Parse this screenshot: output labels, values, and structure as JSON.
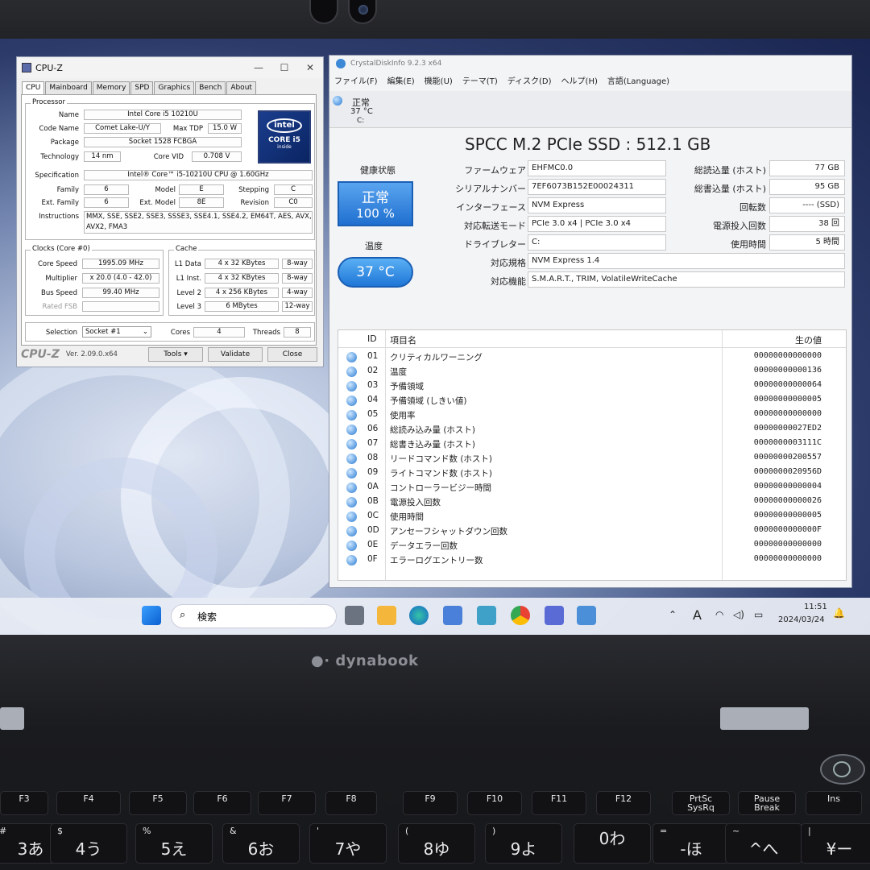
{
  "cpuz": {
    "title": "CPU-Z",
    "tabs": [
      "CPU",
      "Mainboard",
      "Memory",
      "SPD",
      "Graphics",
      "Bench",
      "About"
    ],
    "processor": {
      "group": "Processor",
      "name_label": "Name",
      "name": "Intel Core i5 10210U",
      "codename_label": "Code Name",
      "codename": "Comet Lake-U/Y",
      "tdp_label": "Max TDP",
      "tdp": "15.0 W",
      "package_label": "Package",
      "package": "Socket 1528 FCBGA",
      "tech_label": "Technology",
      "tech": "14 nm",
      "vid_label": "Core VID",
      "vid": "0.708 V",
      "spec_label": "Specification",
      "spec": "Intel® Core™ i5-10210U CPU @ 1.60GHz",
      "family_label": "Family",
      "family": "6",
      "model_label": "Model",
      "model": "E",
      "stepping_label": "Stepping",
      "stepping": "C",
      "extfamily_label": "Ext. Family",
      "extfamily": "6",
      "extmodel_label": "Ext. Model",
      "extmodel": "8E",
      "revision_label": "Revision",
      "revision": "C0",
      "instr_label": "Instructions",
      "instr": "MMX, SSE, SSE2, SSE3, SSSE3, SSE4.1, SSE4.2, EM64T, AES, AVX, AVX2, FMA3",
      "badge_brand": "intel",
      "badge_line": "CORE i5",
      "badge_inside": "inside"
    },
    "clocks": {
      "group": "Clocks (Core #0)",
      "core_speed_label": "Core Speed",
      "core_speed": "1995.09 MHz",
      "multiplier_label": "Multiplier",
      "multiplier": "x 20.0 (4.0 - 42.0)",
      "bus_label": "Bus Speed",
      "bus": "99.40 MHz",
      "fsb_label": "Rated FSB",
      "fsb": ""
    },
    "cache": {
      "group": "Cache",
      "l1d_label": "L1 Data",
      "l1d": "4 x 32 KBytes",
      "l1d_way": "8-way",
      "l1i_label": "L1 Inst.",
      "l1i": "4 x 32 KBytes",
      "l1i_way": "8-way",
      "l2_label": "Level 2",
      "l2": "4 x 256 KBytes",
      "l2_way": "4-way",
      "l3_label": "Level 3",
      "l3": "6 MBytes",
      "l3_way": "12-way"
    },
    "selection_label": "Selection",
    "selection": "Socket #1",
    "cores_label": "Cores",
    "cores": "4",
    "threads_label": "Threads",
    "threads": "8",
    "brand": "CPU-Z",
    "version": "Ver. 2.09.0.x64",
    "tools_label": "Tools",
    "validate_label": "Validate",
    "close_label": "Close"
  },
  "cdi": {
    "title": "CrystalDiskInfo 9.2.3 x64",
    "menu": [
      "ファイル(F)",
      "編集(E)",
      "機能(U)",
      "テーマ(T)",
      "ディスク(D)",
      "ヘルプ(H)",
      "言語(Language)"
    ],
    "drive_status": "正常",
    "drive_temp": "37 °C",
    "drive_letter": "C:",
    "disk_title": "SPCC M.2 PCIe SSD : 512.1 GB",
    "health_label": "健康状態",
    "health_status": "正常",
    "health_pct": "100 %",
    "temp_label": "温度",
    "temp": "37 °C",
    "firmware_label": "ファームウェア",
    "firmware": "EHFMC0.0",
    "serial_label": "シリアルナンバー",
    "serial": "7EF6073B152E00024311",
    "interface_label": "インターフェース",
    "interface": "NVM Express",
    "transfer_label": "対応転送モード",
    "transfer": "PCIe 3.0 x4 | PCIe 3.0 x4",
    "driveletter_label": "ドライブレター",
    "driveletter": "C:",
    "standard_label": "対応規格",
    "standard": "NVM Express 1.4",
    "features_label": "対応機能",
    "features": "S.M.A.R.T., TRIM, VolatileWriteCache",
    "read_label": "総読込量 (ホスト)",
    "read": "77 GB",
    "write_label": "総書込量 (ホスト)",
    "write": "95 GB",
    "rpm_label": "回転数",
    "rpm": "---- (SSD)",
    "poweron_count_label": "電源投入回数",
    "poweron_count": "38 回",
    "hours_label": "使用時間",
    "hours": "5 時間",
    "smart_header": {
      "id": "ID",
      "item": "項目名",
      "raw": "生の値"
    },
    "smart": [
      {
        "id": "01",
        "name": "クリティカルワーニング",
        "raw": "00000000000000"
      },
      {
        "id": "02",
        "name": "温度",
        "raw": "00000000000136"
      },
      {
        "id": "03",
        "name": "予備領域",
        "raw": "00000000000064"
      },
      {
        "id": "04",
        "name": "予備領域 (しきい値)",
        "raw": "00000000000005"
      },
      {
        "id": "05",
        "name": "使用率",
        "raw": "00000000000000"
      },
      {
        "id": "06",
        "name": "総読み込み量 (ホスト)",
        "raw": "00000000027ED2"
      },
      {
        "id": "07",
        "name": "総書き込み量 (ホスト)",
        "raw": "0000000003111C"
      },
      {
        "id": "08",
        "name": "リードコマンド数 (ホスト)",
        "raw": "00000000200557"
      },
      {
        "id": "09",
        "name": "ライトコマンド数 (ホスト)",
        "raw": "0000000020956D"
      },
      {
        "id": "0A",
        "name": "コントローラービジー時間",
        "raw": "00000000000004"
      },
      {
        "id": "0B",
        "name": "電源投入回数",
        "raw": "00000000000026"
      },
      {
        "id": "0C",
        "name": "使用時間",
        "raw": "00000000000005"
      },
      {
        "id": "0D",
        "name": "アンセーフシャットダウン回数",
        "raw": "0000000000000F"
      },
      {
        "id": "0E",
        "name": "データエラー回数",
        "raw": "00000000000000"
      },
      {
        "id": "0F",
        "name": "エラーログエントリー数",
        "raw": "00000000000000"
      }
    ]
  },
  "taskbar": {
    "search_placeholder": "検索",
    "ime": "A",
    "time": "11:51",
    "date": "2024/03/24"
  },
  "laptop": {
    "brand": "dynabook"
  },
  "keyboard": {
    "fn_keys": [
      {
        "t": "F3",
        "b": ""
      },
      {
        "t": "F4",
        "b": ""
      },
      {
        "t": "F5",
        "b": ""
      },
      {
        "t": "F6",
        "b": ""
      },
      {
        "t": "F7",
        "b": ""
      },
      {
        "t": "F8",
        "b": ""
      },
      {
        "t": "F9",
        "b": ""
      },
      {
        "t": "F10",
        "b": ""
      },
      {
        "t": "F11",
        "b": ""
      },
      {
        "t": "F12",
        "b": ""
      },
      {
        "t": "PrtSc",
        "b": "SysRq"
      },
      {
        "t": "Pause",
        "b": "Break"
      },
      {
        "t": "Ins",
        "b": ""
      }
    ],
    "num_keys": [
      {
        "t": "#",
        "b": "3あ"
      },
      {
        "t": "$",
        "b": "4う"
      },
      {
        "t": "%",
        "b": "5え"
      },
      {
        "t": "&",
        "b": "6お"
      },
      {
        "t": "'",
        "b": "7や"
      },
      {
        "t": "(",
        "b": "8ゆ"
      },
      {
        "t": ")",
        "b": "9よ"
      },
      {
        "t": "",
        "b": "0わ"
      },
      {
        "t": "=",
        "b": "-ほ"
      },
      {
        "t": "~",
        "b": "^へ"
      },
      {
        "t": "|",
        "b": "¥ー"
      }
    ]
  },
  "colors": {
    "health_blue": "#1f6fd0",
    "smart_dot": "#2679d2"
  }
}
